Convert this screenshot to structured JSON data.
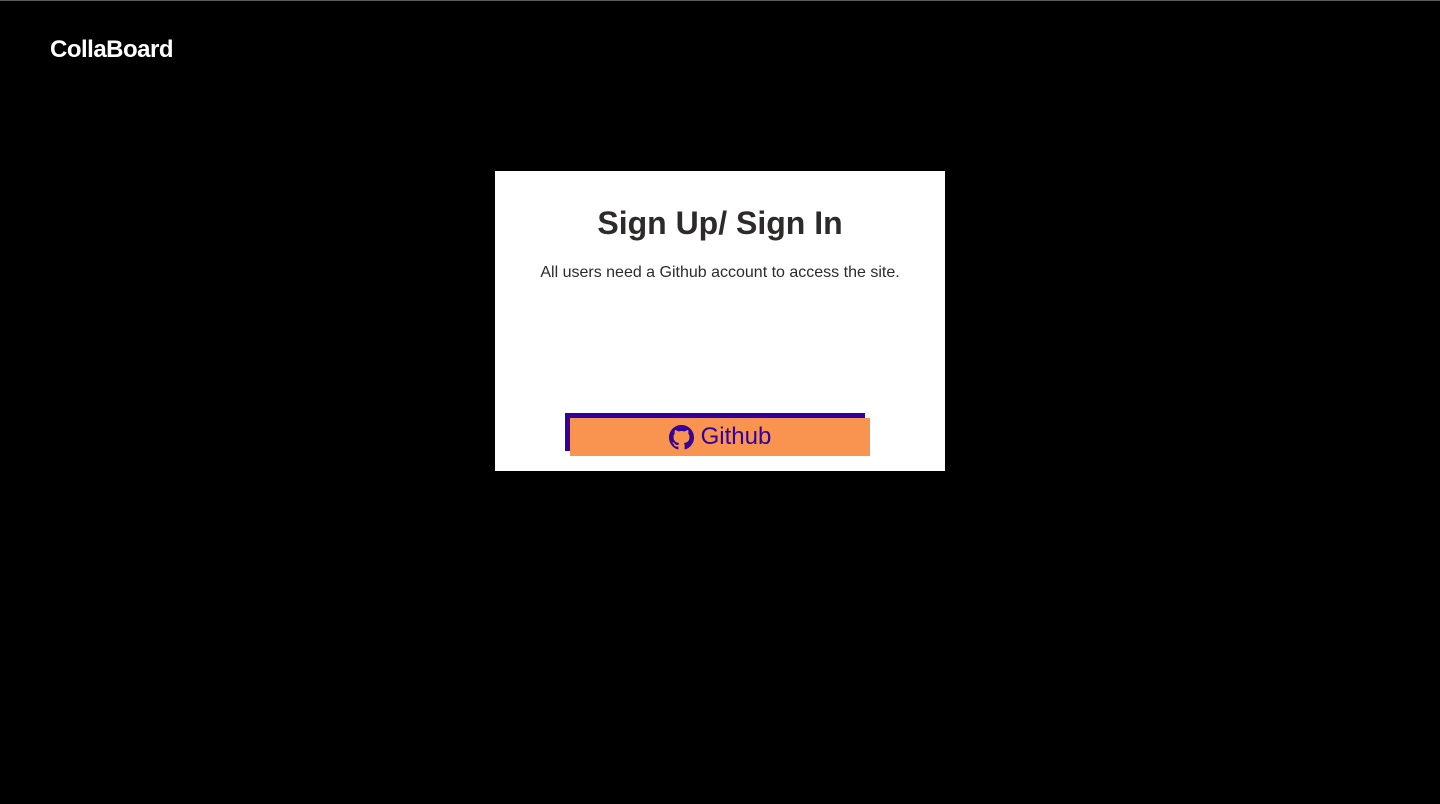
{
  "header": {
    "brand": "CollaBoard"
  },
  "auth_card": {
    "title": "Sign Up/ Sign In",
    "description": "All users need a Github account to access the site.",
    "github_button": {
      "label": "Github",
      "icon": "github-icon"
    }
  },
  "colors": {
    "page_background": "#000000",
    "card_background": "#ffffff",
    "text_dark": "#2f2a2a",
    "button_background": "#f99350",
    "button_shadow": "#33009b",
    "button_text": "#33009b"
  }
}
